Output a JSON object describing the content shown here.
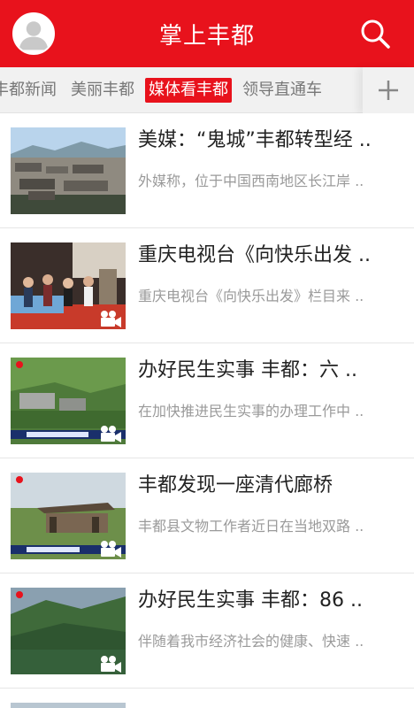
{
  "header": {
    "title": "掌上丰都",
    "avatar_icon": "user-avatar-icon",
    "search_icon": "search-icon",
    "bg_color": "#e8121c"
  },
  "tabs": {
    "items": [
      {
        "label": "丰都新闻"
      },
      {
        "label": "美丽丰都"
      },
      {
        "label": "媒体看丰都",
        "active": true
      },
      {
        "label": "领导直通车"
      }
    ],
    "add_icon": "plus-icon"
  },
  "articles": [
    {
      "title": "美媒：“鬼城”丰都转型经 ..",
      "desc": "外媒称，位于中国西南地区长江岸 ..",
      "video": false
    },
    {
      "title": "重庆电视台《向快乐出发 ..",
      "desc": "重庆电视台《向快乐出发》栏目来 ..",
      "video": true
    },
    {
      "title": "办好民生实事 丰都：六 ..",
      "desc": "在加快推进民生实事的办理工作中 ..",
      "video": true
    },
    {
      "title": "丰都发现一座清代廊桥",
      "desc": "丰都县文物工作者近日在当地双路 ..",
      "video": true
    },
    {
      "title": "办好民生实事 丰都：86 ..",
      "desc": "伴随着我市经济社会的健康、快速 ..",
      "video": true
    }
  ]
}
